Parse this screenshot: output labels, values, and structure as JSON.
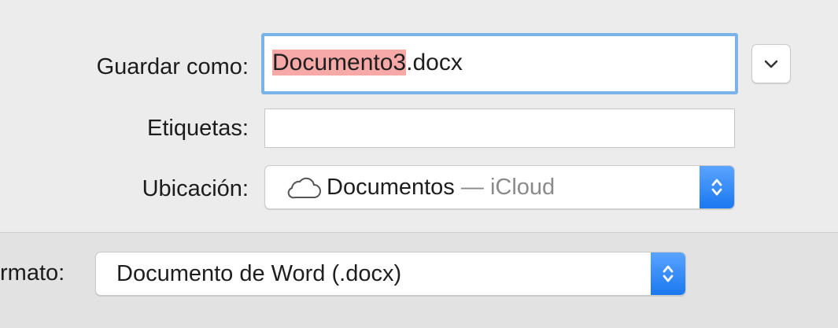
{
  "save_as": {
    "label": "Guardar como:",
    "filename_selected": "Documento3",
    "filename_ext": ".docx",
    "expand_icon": "chevron-down-icon"
  },
  "tags": {
    "label": "Etiquetas:",
    "value": ""
  },
  "location": {
    "label": "Ubicación:",
    "icon": "cloud-icon",
    "value": "Documentos",
    "separator": " — ",
    "service": "iCloud"
  },
  "format": {
    "label": "rmato:",
    "value": "Documento de Word (.docx)"
  },
  "colors": {
    "focus_ring": "#7ab2ea",
    "selection": "#f6a9a7",
    "stepper": "#1a78f0"
  }
}
